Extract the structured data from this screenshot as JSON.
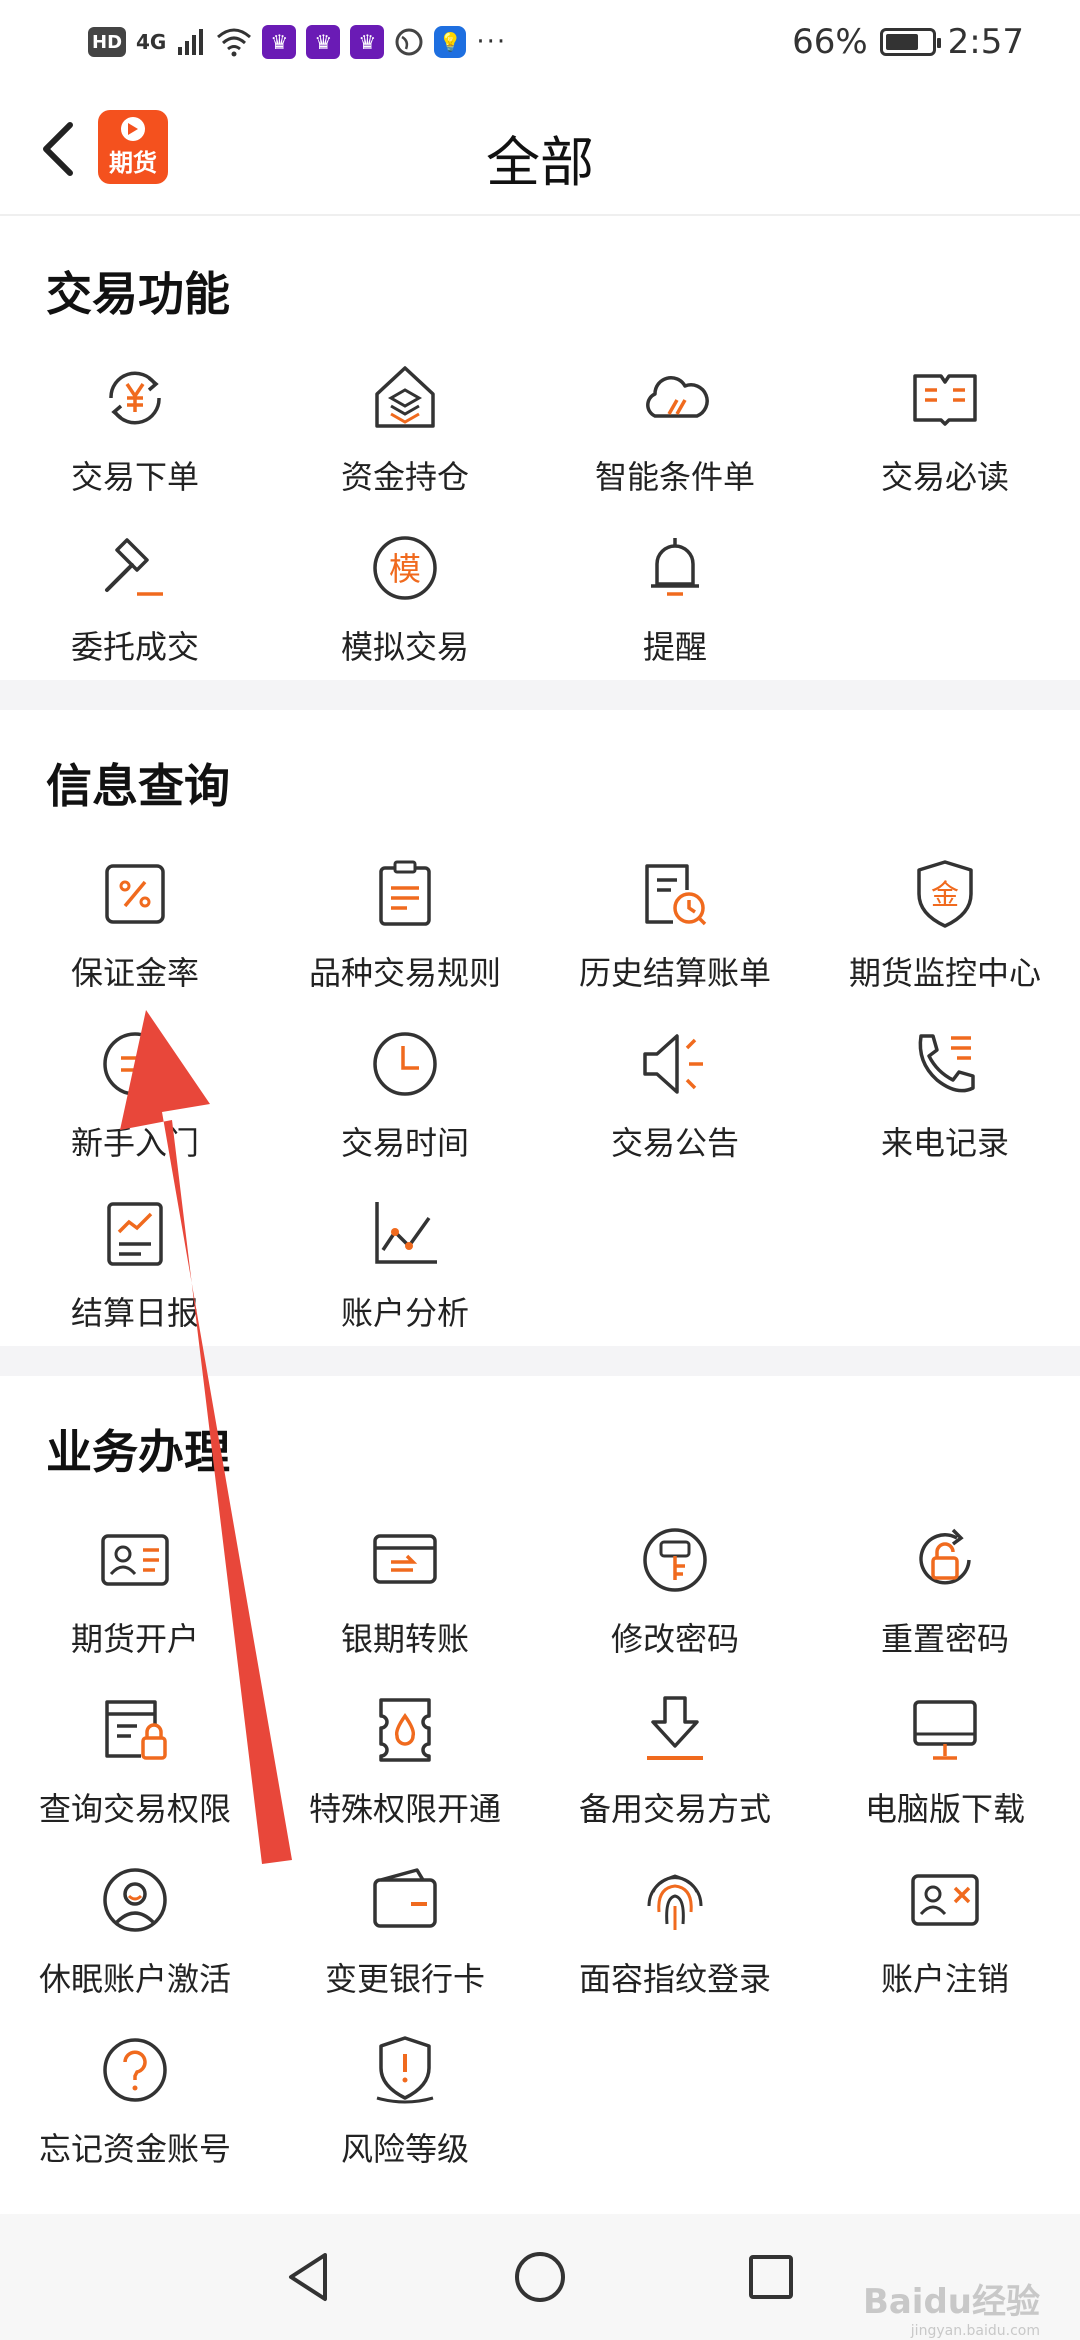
{
  "status_bar": {
    "left_chips": [
      "HD",
      "4G"
    ],
    "battery_percent": "66%",
    "time": "2:57",
    "battery_level": 0.66
  },
  "header": {
    "logo_text": "期货",
    "title": "全部"
  },
  "sections": [
    {
      "title": "交易功能",
      "items": [
        {
          "label": "交易下单",
          "icon": "yen-cycle-icon"
        },
        {
          "label": "资金持仓",
          "icon": "house-layers-icon"
        },
        {
          "label": "智能条件单",
          "icon": "cloud-icon"
        },
        {
          "label": "交易必读",
          "icon": "open-book-icon"
        },
        {
          "label": "委托成交",
          "icon": "gavel-icon"
        },
        {
          "label": "模拟交易",
          "icon": "mo-circle-icon"
        },
        {
          "label": "提醒",
          "icon": "bell-icon"
        }
      ]
    },
    {
      "title": "信息查询",
      "items": [
        {
          "label": "保证金率",
          "icon": "percent-icon"
        },
        {
          "label": "品种交易规则",
          "icon": "clipboard-icon"
        },
        {
          "label": "历史结算账单",
          "icon": "doc-clock-icon"
        },
        {
          "label": "期货监控中心",
          "icon": "shield-gold-icon"
        },
        {
          "label": "新手入门",
          "icon": "beginner-icon"
        },
        {
          "label": "交易时间",
          "icon": "clock-icon"
        },
        {
          "label": "交易公告",
          "icon": "speaker-icon"
        },
        {
          "label": "来电记录",
          "icon": "phone-list-icon"
        },
        {
          "label": "结算日报",
          "icon": "report-chart-icon"
        },
        {
          "label": "账户分析",
          "icon": "line-chart-icon"
        }
      ]
    },
    {
      "title": "业务办理",
      "items": [
        {
          "label": "期货开户",
          "icon": "id-card-icon"
        },
        {
          "label": "银期转账",
          "icon": "card-transfer-icon"
        },
        {
          "label": "修改密码",
          "icon": "password-edit-icon"
        },
        {
          "label": "重置密码",
          "icon": "lock-reset-icon"
        },
        {
          "label": "查询交易权限",
          "icon": "doc-lock-icon"
        },
        {
          "label": "特殊权限开通",
          "icon": "ticket-drop-icon"
        },
        {
          "label": "备用交易方式",
          "icon": "download-arrow-icon"
        },
        {
          "label": "电脑版下载",
          "icon": "monitor-icon"
        },
        {
          "label": "休眠账户激活",
          "icon": "sleep-face-icon"
        },
        {
          "label": "变更银行卡",
          "icon": "wallet-icon"
        },
        {
          "label": "面容指纹登录",
          "icon": "fingerprint-icon"
        },
        {
          "label": "账户注销",
          "icon": "id-cancel-icon"
        },
        {
          "label": "忘记资金账号",
          "icon": "question-icon"
        },
        {
          "label": "风险等级",
          "icon": "warning-shield-icon"
        }
      ]
    }
  ],
  "watermark": {
    "text": "Baidu经验",
    "sub": "jingyan.baidu.com"
  },
  "colors": {
    "accent": "#f06a1e",
    "annotation": "#e8473a"
  }
}
